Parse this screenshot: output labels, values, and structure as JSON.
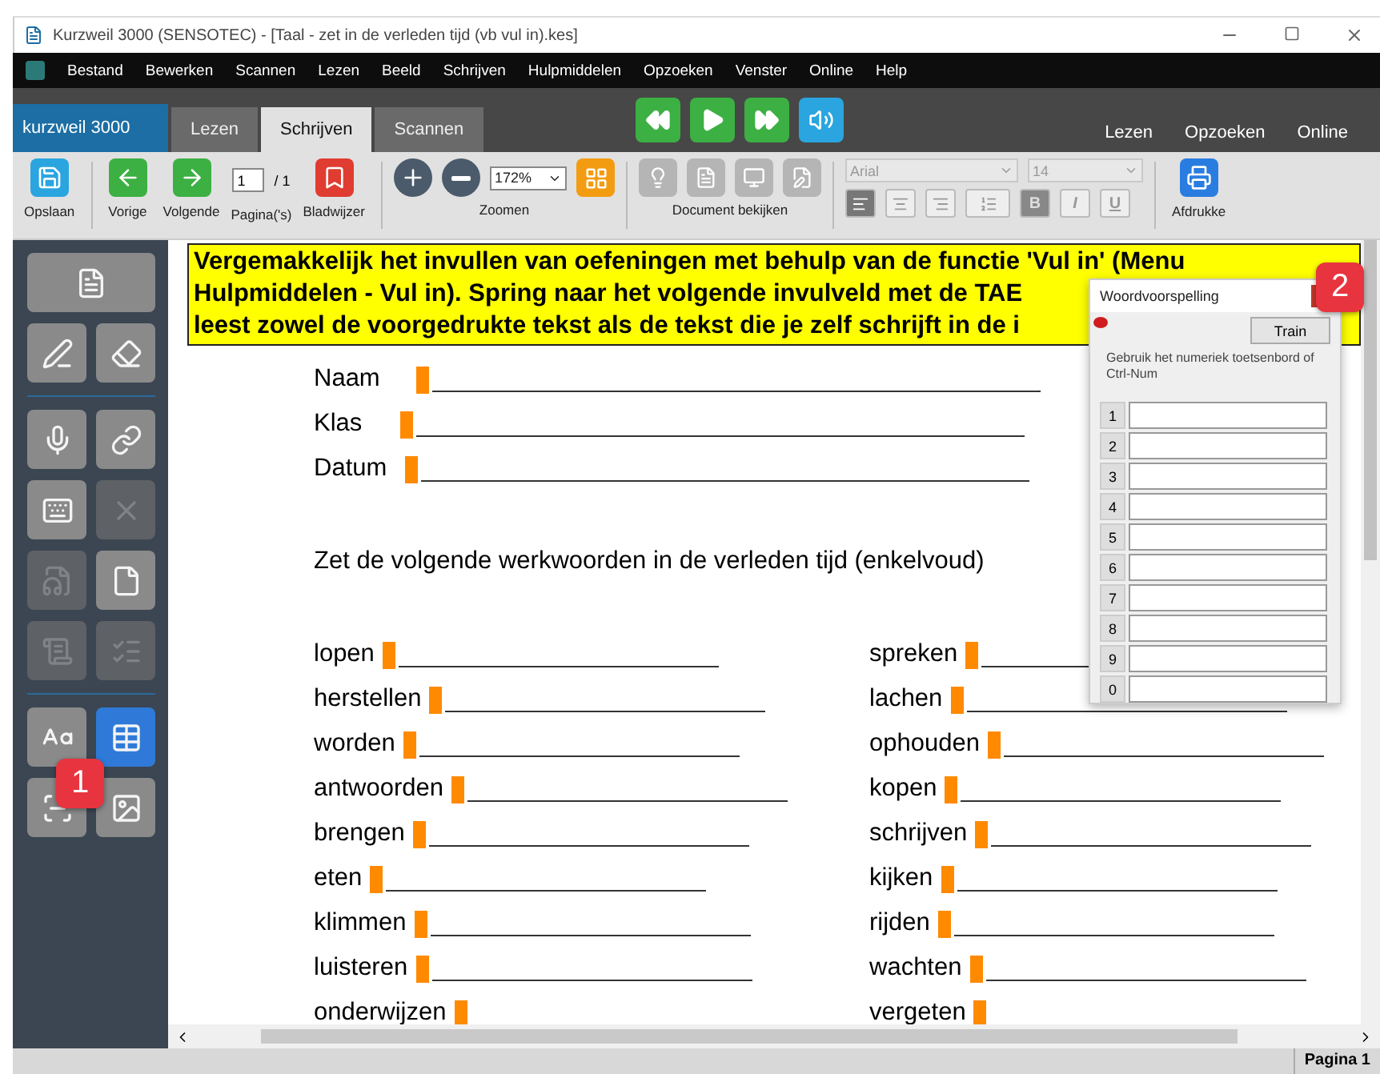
{
  "window": {
    "title": "Kurzweil 3000 (SENSOTEC) - [Taal - zet in de verleden tijd (vb vul in).kes]"
  },
  "menu": [
    "Bestand",
    "Bewerken",
    "Scannen",
    "Lezen",
    "Beeld",
    "Schrijven",
    "Hulpmiddelen",
    "Opzoeken",
    "Venster",
    "Online",
    "Help"
  ],
  "app_bar": {
    "logo": "kurzweil 3000",
    "tabs": [
      {
        "label": "Lezen",
        "selected": false
      },
      {
        "label": "Schrijven",
        "selected": true
      },
      {
        "label": "Scannen",
        "selected": false
      }
    ],
    "links": [
      "Lezen",
      "Opzoeken",
      "Online"
    ]
  },
  "toolbar": {
    "save": "Opslaan",
    "prev": "Vorige",
    "next": "Volgende",
    "page_value": "1",
    "page_total": "/ 1",
    "pages_label": "Pagina('s)",
    "bookmark": "Bladwijzer",
    "zoom_value": "172%",
    "zoom_label": "Zoomen",
    "view_label": "Document bekijken",
    "font": "Arial",
    "size": "14",
    "align": [
      {
        "selected": true
      },
      {
        "selected": false
      },
      {
        "selected": false
      }
    ],
    "format": [
      "B",
      "I",
      "U"
    ],
    "print": "Afdrukke"
  },
  "sidebar": [
    {
      "kind": "wide",
      "disabled": false,
      "selected": false
    },
    {
      "kind": "square",
      "disabled": false,
      "selected": false
    },
    {
      "kind": "square",
      "disabled": false,
      "selected": false
    },
    {
      "kind": "divider"
    },
    {
      "kind": "square",
      "disabled": false,
      "selected": false
    },
    {
      "kind": "square",
      "disabled": false,
      "selected": false
    },
    {
      "kind": "square",
      "disabled": false,
      "selected": false
    },
    {
      "kind": "square",
      "disabled": true,
      "selected": false
    },
    {
      "kind": "square",
      "disabled": true,
      "selected": false
    },
    {
      "kind": "square",
      "disabled": false,
      "selected": false
    },
    {
      "kind": "square",
      "disabled": true,
      "selected": false
    },
    {
      "kind": "square",
      "disabled": true,
      "selected": false
    },
    {
      "kind": "divider"
    },
    {
      "kind": "square",
      "disabled": false,
      "selected": false
    },
    {
      "kind": "square",
      "disabled": false,
      "selected": true
    },
    {
      "kind": "square",
      "disabled": false,
      "selected": false
    },
    {
      "kind": "square",
      "disabled": false,
      "selected": false
    }
  ],
  "document": {
    "instructions": [
      "Vergemakkelijk het invullen van oefeningen met behulp van de functie 'Vul in' (Menu",
      "Hulpmiddelen - Vul in). Spring naar het volgende invulveld met de TAE",
      "leest zowel de voorgedrukte tekst als de tekst die je zelf schrijft in de i"
    ],
    "fields": [
      "Naam",
      "Klas",
      "Datum"
    ],
    "heading": "Zet de volgende werkwoorden in de verleden tijd (enkelvoud)",
    "verbs_left": [
      "lopen",
      "herstellen",
      "worden",
      "antwoorden",
      "brengen",
      "eten",
      "klimmen",
      "luisteren",
      "onderwijzen"
    ],
    "verbs_right": [
      "spreken",
      "lachen",
      "ophouden",
      "kopen",
      "schrijven",
      "kijken",
      "rijden",
      "wachten",
      "vergeten"
    ]
  },
  "prediction": {
    "title": "Woordvoorspelling",
    "train": "Train",
    "hint": "Gebruik het numeriek toetsenbord of Ctrl-Num",
    "slots": [
      "1",
      "2",
      "3",
      "4",
      "5",
      "6",
      "7",
      "8",
      "9",
      "0"
    ]
  },
  "callouts": [
    "1",
    "2"
  ],
  "status": "Pagina 1"
}
